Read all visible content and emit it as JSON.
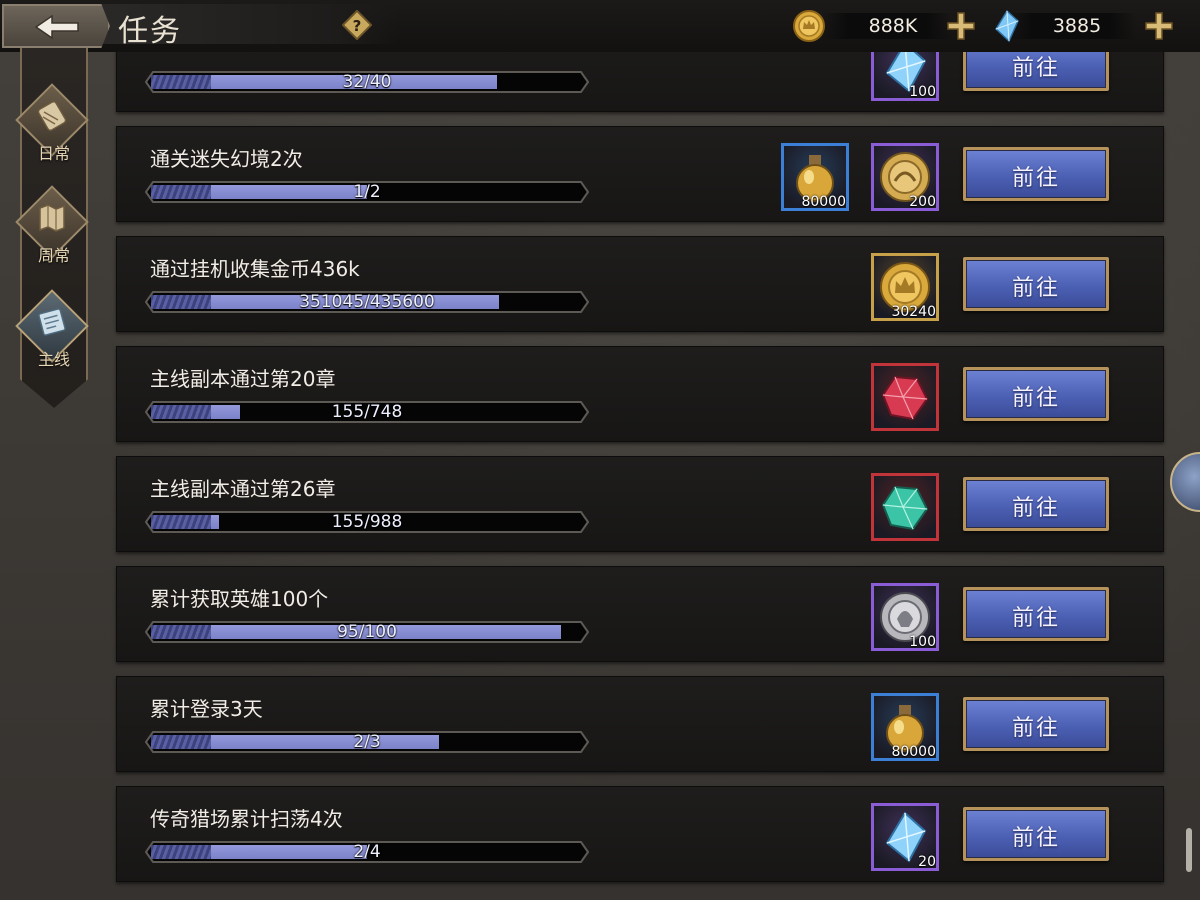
{
  "header": {
    "title": "任务",
    "help_glyph": "?",
    "currencies": [
      {
        "name": "gold-coin-icon",
        "amount": "888K"
      },
      {
        "name": "blue-crystal-icon",
        "amount": "3885"
      }
    ]
  },
  "sidebar": {
    "tabs": [
      {
        "label": "日常",
        "active": false
      },
      {
        "label": "周常",
        "active": false
      },
      {
        "label": "主线",
        "active": true
      }
    ]
  },
  "colors": {
    "fill": "#7c82c8",
    "button": "#4c60b4",
    "rarity_purple": "#8a5cd6",
    "rarity_blue": "#3b7fd6",
    "rarity_gold": "#c7a04a",
    "rarity_red": "#c0343a"
  },
  "tasks": [
    {
      "title": "",
      "progress_text": "32/40",
      "progress": 0.8,
      "rewards": [
        {
          "icon": "blue-crystal-icon",
          "qty": "100",
          "rarity": "purple"
        }
      ],
      "button_label": "前往"
    },
    {
      "title": "通关迷失幻境2次",
      "progress_text": "1/2",
      "progress": 0.5,
      "rewards": [
        {
          "icon": "potion-flask-icon",
          "qty": "80000",
          "rarity": "blue"
        },
        {
          "icon": "medal-coin-icon",
          "qty": "200",
          "rarity": "purple"
        }
      ],
      "button_label": "前往"
    },
    {
      "title": "通过挂机收集金币436k",
      "progress_text": "351045/435600",
      "progress": 0.806,
      "rewards": [
        {
          "icon": "gold-coin-icon",
          "qty": "30240",
          "rarity": "gold"
        }
      ],
      "button_label": "前往"
    },
    {
      "title": "主线副本通过第20章",
      "progress_text": "155/748",
      "progress": 0.207,
      "rewards": [
        {
          "icon": "red-gem-icon",
          "qty": "",
          "rarity": "red"
        }
      ],
      "button_label": "前往"
    },
    {
      "title": "主线副本通过第26章",
      "progress_text": "155/988",
      "progress": 0.157,
      "rewards": [
        {
          "icon": "green-gem-icon",
          "qty": "",
          "rarity": "red"
        }
      ],
      "button_label": "前往"
    },
    {
      "title": "累计获取英雄100个",
      "progress_text": "95/100",
      "progress": 0.95,
      "rewards": [
        {
          "icon": "silver-coin-icon",
          "qty": "100",
          "rarity": "purple"
        }
      ],
      "button_label": "前往"
    },
    {
      "title": "累计登录3天",
      "progress_text": "2/3",
      "progress": 0.667,
      "rewards": [
        {
          "icon": "potion-flask-icon",
          "qty": "80000",
          "rarity": "blue"
        }
      ],
      "button_label": "前往"
    },
    {
      "title": "传奇猎场累计扫荡4次",
      "progress_text": "2/4",
      "progress": 0.5,
      "rewards": [
        {
          "icon": "blue-crystal-icon",
          "qty": "20",
          "rarity": "purple"
        }
      ],
      "button_label": "前往"
    }
  ]
}
